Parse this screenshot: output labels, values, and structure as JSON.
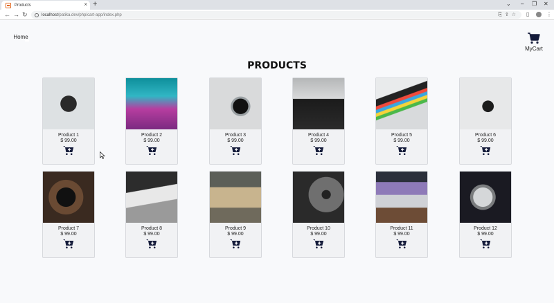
{
  "browser": {
    "tab_title": "Products",
    "url_host": "localhost",
    "url_path": "/patika.dev/php/cart-app/index.php"
  },
  "header": {
    "home_label": "Home",
    "cart_label": "MyCart"
  },
  "page_title": "PRODUCTS",
  "add_to_cart_icon": "cart-plus-icon",
  "products": [
    {
      "name": "Product 1",
      "price": "$ 99.00"
    },
    {
      "name": "Product 2",
      "price": "$ 99.00"
    },
    {
      "name": "Product 3",
      "price": "$ 99.00"
    },
    {
      "name": "Product 4",
      "price": "$ 99.00"
    },
    {
      "name": "Product 5",
      "price": "$ 99.00"
    },
    {
      "name": "Product 6",
      "price": "$ 99.00"
    },
    {
      "name": "Product 7",
      "price": "$ 99.00"
    },
    {
      "name": "Product 8",
      "price": "$ 99.00"
    },
    {
      "name": "Product 9",
      "price": "$ 99.00"
    },
    {
      "name": "Product 10",
      "price": "$ 99.00"
    },
    {
      "name": "Product 11",
      "price": "$ 99.00"
    },
    {
      "name": "Product 12",
      "price": "$ 99.00"
    }
  ],
  "colors": {
    "accent": "#141b3a"
  }
}
